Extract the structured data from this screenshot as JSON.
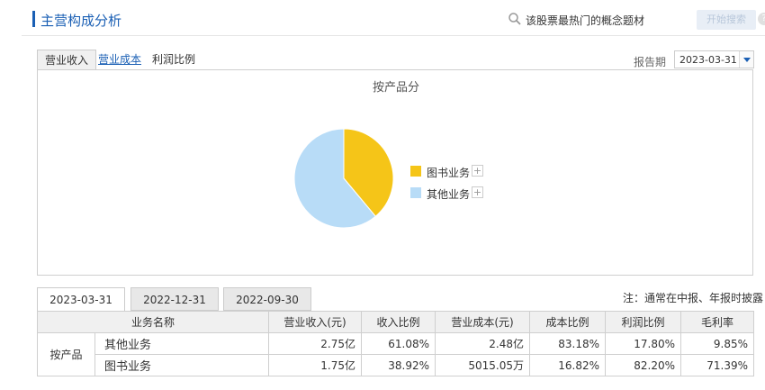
{
  "header": {
    "title": "主营构成分析",
    "concept_text": "该股票最热门的概念题材",
    "start_button": "开始搜索",
    "help": "?"
  },
  "tabs": [
    {
      "label": "营业收入"
    },
    {
      "label": "营业成本"
    },
    {
      "label": "利润比例"
    }
  ],
  "period": {
    "label": "报告期",
    "selected": "2023-03-31"
  },
  "chart_data": {
    "type": "pie",
    "title": "按产品分",
    "slices": [
      {
        "name": "图书业务",
        "value": 38.92,
        "color": "#f5c518"
      },
      {
        "name": "其他业务",
        "value": 61.08,
        "color": "#b8dcf7"
      }
    ],
    "legend_placement": "right"
  },
  "legend": {
    "items": [
      {
        "label": "图书业务",
        "color": "#f5c518",
        "plus": "+"
      },
      {
        "label": "其他业务",
        "color": "#b8dcf7",
        "plus": "+"
      }
    ]
  },
  "date_tabs": [
    "2023-03-31",
    "2022-12-31",
    "2022-09-30"
  ],
  "note": "注：通常在中报、年报时披露",
  "table": {
    "headers": [
      "业务名称",
      "营业收入(元)",
      "收入比例",
      "营业成本(元)",
      "成本比例",
      "利润比例",
      "毛利率"
    ],
    "group": "按产品",
    "rows": [
      {
        "name": "其他业务",
        "revenue": "2.75亿",
        "rev_ratio": "61.08%",
        "cost": "2.48亿",
        "cost_ratio": "83.18%",
        "profit_ratio": "17.80%",
        "margin": "9.85%"
      },
      {
        "name": "图书业务",
        "revenue": "1.75亿",
        "rev_ratio": "38.92%",
        "cost": "5015.05万",
        "cost_ratio": "16.82%",
        "profit_ratio": "82.20%",
        "margin": "71.39%"
      }
    ]
  }
}
